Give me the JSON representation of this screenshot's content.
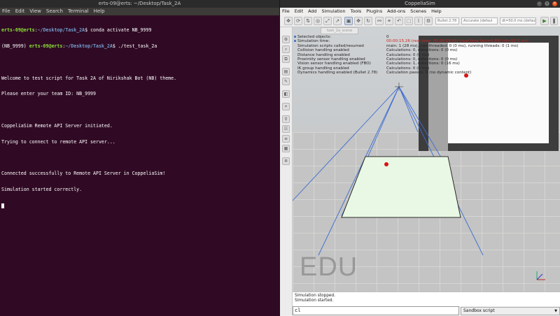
{
  "terminal": {
    "title": "erts-09@erts: ~/Desktop/Task_2A",
    "menu": [
      "File",
      "Edit",
      "View",
      "Search",
      "Terminal",
      "Help"
    ],
    "lines": [
      {
        "user": "erts-09@erts",
        "path": "~/Desktop/Task_2A",
        "sym": "$",
        "cmd": " conda activate NB_9999",
        "env": ""
      },
      {
        "user": "erts-09@erts",
        "path": "~/Desktop/Task_2A",
        "sym": "$",
        "cmd": " ./test_task_2a",
        "env": "(NB_9999) "
      },
      {
        "text": ""
      },
      {
        "text": "Welcome to test script for Task 2A of Nirikshak Bot (NB) theme."
      },
      {
        "text": "Please enter your team ID: NB_9999"
      },
      {
        "text": ""
      },
      {
        "text": "CoppeliaSim Remote API Server initiated."
      },
      {
        "text": "Trying to connect to remote API server..."
      },
      {
        "text": ""
      },
      {
        "text": "Connected successfully to Remote API Server in CoppeliaSim!"
      },
      {
        "text": "Simulation started correctly."
      }
    ]
  },
  "coppelia": {
    "title": "CoppeliaSim",
    "menu": [
      "File",
      "Edit",
      "Add",
      "Simulation",
      "Tools",
      "Plugins",
      "Add-ons",
      "Scenes",
      "Help"
    ],
    "toolbar": {
      "engine": "Bullet 2.78",
      "accuracy": "Accurate (defaul",
      "dt": "dt=50.0 ms (default)"
    },
    "scene_tab": "task_2a_scene",
    "info": [
      {
        "k": "Selected objects:",
        "v": "0",
        "red": false
      },
      {
        "k": "Simulation time:",
        "v": "00:00:15.26 (real time: 00:00:18.01) (real time fact=0.85) (dt=50.0 ms)",
        "red": true
      },
      {
        "k": "Simulation scripts called/resumed",
        "v": "main: 1 (28 ms), non-threaded: 0 (0 ms), running threads: 0 (1 ms)",
        "red": false
      },
      {
        "k": "Collision handling enabled",
        "v": "Calculations: 0, detections: 0 (0 ms)",
        "red": false
      },
      {
        "k": "Distance handling enabled",
        "v": "Calculations: 0 (0 ms)",
        "red": false
      },
      {
        "k": "Proximity sensor handling enabled",
        "v": "Calculations: 0, detections: 0 (0 ms)",
        "red": false
      },
      {
        "k": "Vision sensor handling enabled (FBO)",
        "v": "Calculations: 1, detections: 0 (16 ms)",
        "red": false
      },
      {
        "k": "IK group handling enabled",
        "v": "Calculations: 0 (0 ms)",
        "red": false
      },
      {
        "k": "Dynamics handling enabled (Bullet 2.78)",
        "v": "Calculation passes: 0 (no dynamic content)",
        "red": false
      }
    ],
    "watermark": "EDU",
    "status": [
      "Simulation stopped.",
      "Simulation started."
    ],
    "command_input": "cl",
    "script_select": "Sandbox script",
    "colors": {
      "accent": "#e95420",
      "plane": "#e9f8e4",
      "ball": "#d91515",
      "beam": "#3e6cd1"
    }
  }
}
